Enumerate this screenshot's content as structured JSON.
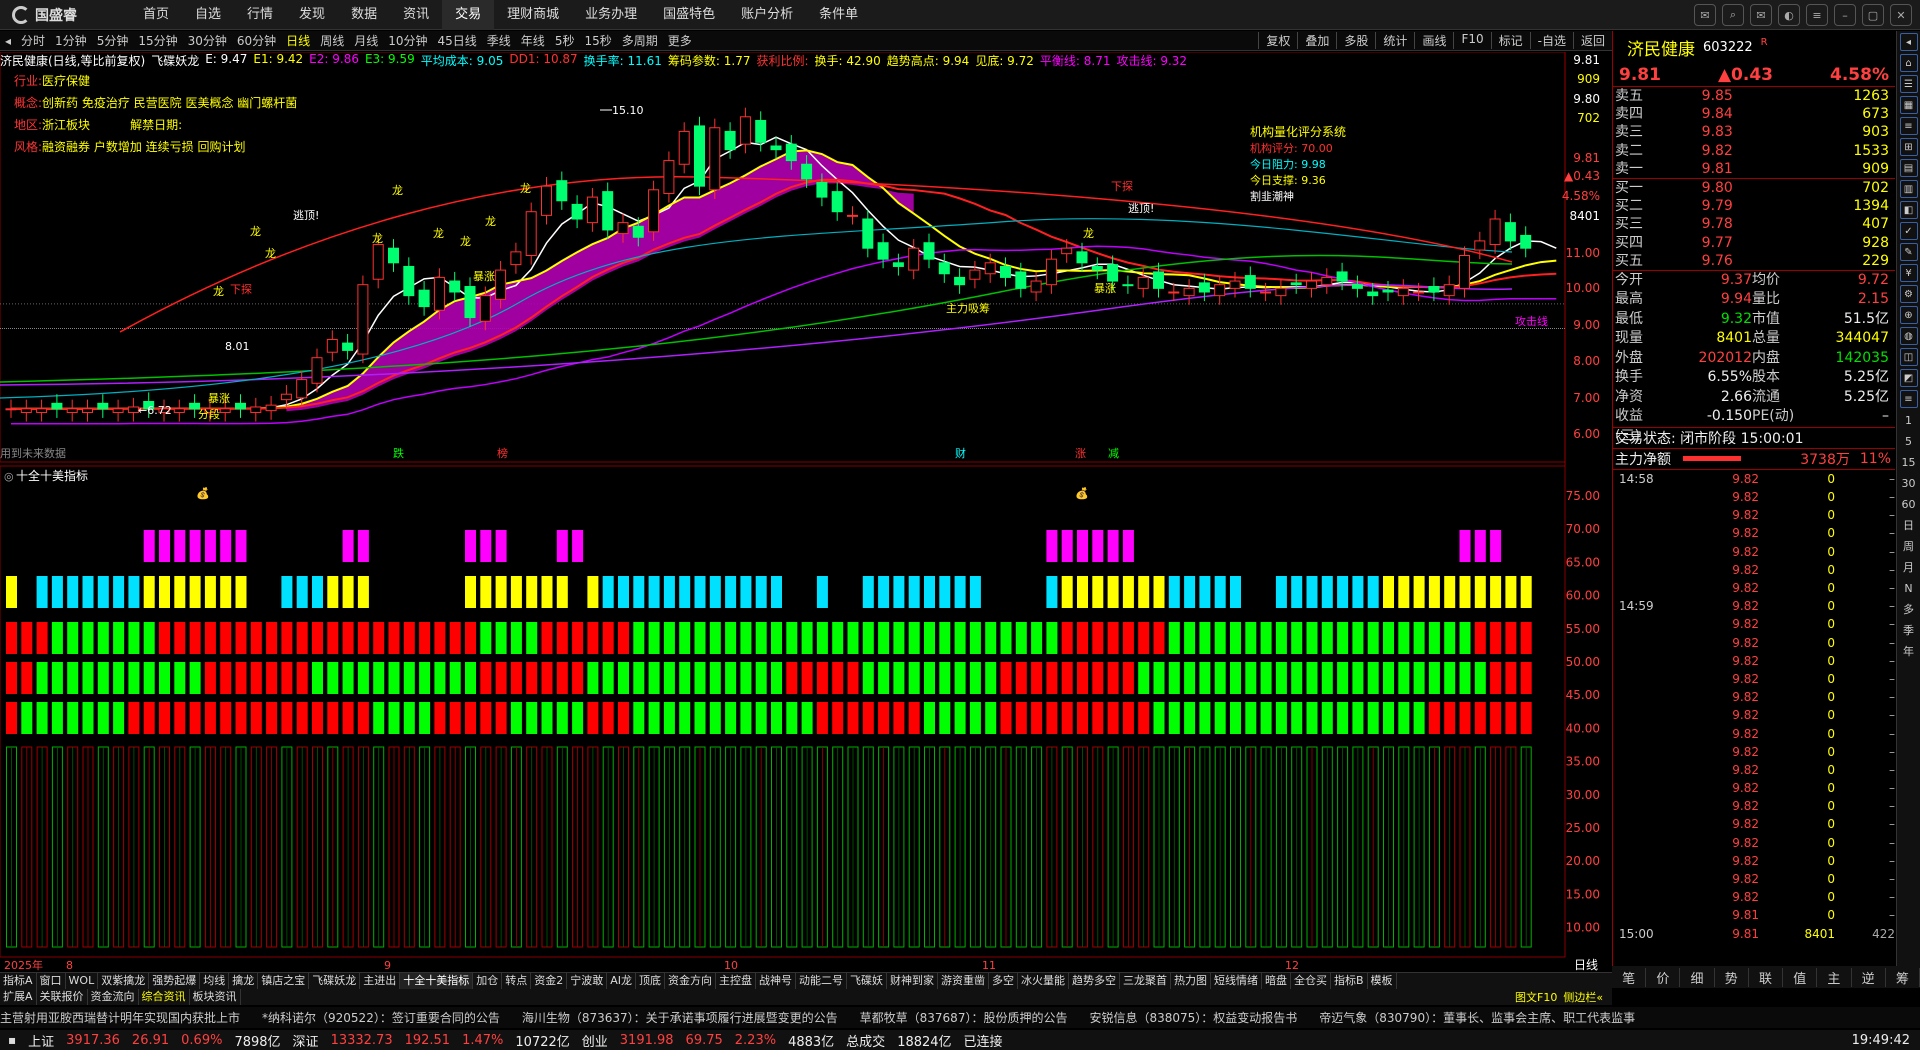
{
  "app": {
    "logo": "国盛睿",
    "menu": [
      "首页",
      "自选",
      "行情",
      "发现",
      "数据",
      "资讯",
      "交易",
      "理财商城",
      "业务办理",
      "国盛特色",
      "账户分析",
      "条件单"
    ],
    "active": "交易"
  },
  "periods": [
    "分时",
    "1分钟",
    "5分钟",
    "15分钟",
    "30分钟",
    "60分钟",
    "日线",
    "周线",
    "月线",
    "10分钟",
    "45日线",
    "季线",
    "年线",
    "5秒",
    "15秒",
    "多周期",
    "更多"
  ],
  "active_period": "日线",
  "toolbar": [
    "复权",
    "叠加",
    "多股",
    "统计",
    "画线",
    "F10",
    "标记",
    "-自选",
    "返回"
  ],
  "chart": {
    "title": "济民健康(日线,等比前复权)",
    "indicator": "飞碟妖龙",
    "items": [
      {
        "t": "E: 9.47",
        "c": "#ffffff"
      },
      {
        "t": "E1: 9.42",
        "c": "#ffff00"
      },
      {
        "t": "E2: 9.86",
        "c": "#ff00ff"
      },
      {
        "t": "E3: 9.59",
        "c": "#00ff00"
      },
      {
        "t": "平均成本: 9.05",
        "c": "#00ffff"
      },
      {
        "t": "DD1: 10.87",
        "c": "#ff3030"
      },
      {
        "t": "换手率: 11.61",
        "c": "#00ffff"
      },
      {
        "t": "筹码参数: 1.77",
        "c": "#ffff00"
      },
      {
        "t": "获利比例:",
        "c": "#ff3030"
      },
      {
        "t": "换手: 42.90",
        "c": "#ffff00"
      },
      {
        "t": "趋势高点: 9.94",
        "c": "#ffff00"
      },
      {
        "t": "见底: 9.72",
        "c": "#ffff00"
      },
      {
        "t": "平衡线: 8.71",
        "c": "#ff00ff"
      },
      {
        "t": "攻击线: 9.32",
        "c": "#ff00ff"
      }
    ],
    "meta": [
      {
        "k": "行业:",
        "v": "医疗保健"
      },
      {
        "k": "概念:",
        "v": "创新药 免疫治疗 民营医院 医美概念 幽门螺杆菌"
      },
      {
        "k": "地区:",
        "v": "浙江板块",
        "k2": "解禁日期:"
      },
      {
        "k": "风格:",
        "v": "融资融券 户数增加 连续亏损 回购计划"
      }
    ],
    "system": {
      "title": "机构量化评分系统",
      "score": "机构评分: 70.00",
      "res": "今日阻力: 9.98",
      "sup": "今日支撑: 9.36",
      "note": "割韭潮神"
    },
    "labels": {
      "hi": "15.10",
      "lo": "6.72",
      "low2": "8.01",
      "tao": "逃顶!",
      "tao2": "逃顶!",
      "zhang1": "暴涨",
      "zhang2": "暴涨",
      "zhang3": "暴涨",
      "xb": "下探",
      "xb2": "下探",
      "zl": "主力吸筹",
      "gj": "攻击线",
      "fen": "分段",
      "dragon": "龙",
      "wuting": "用到未来数据"
    },
    "markers": [
      "跌",
      "榜",
      "财",
      "涨",
      "减"
    ],
    "yaxis": [
      "9.81",
      "909",
      "9.80",
      "702",
      "9.81",
      "▲0.43",
      "4.58%",
      "8401",
      "11.00",
      "10.00",
      "9.00",
      "8.00",
      "7.00",
      "6.00"
    ],
    "lower_title": "十全十美指标",
    "lower_axis": [
      "75.00",
      "70.00",
      "65.00",
      "60.00",
      "55.00",
      "50.00",
      "45.00",
      "40.00",
      "35.00",
      "30.00",
      "25.00",
      "20.00",
      "15.00",
      "10.00"
    ],
    "xaxis": [
      "2025年",
      "8",
      "9",
      "10",
      "11",
      "12"
    ],
    "period_label": "日线"
  },
  "quote": {
    "name": "济民健康",
    "code": "603222",
    "flag": "R",
    "price": "9.81",
    "chg": "▲0.43",
    "pct": "4.58%",
    "asks": [
      [
        "卖五",
        "9.85",
        "1263"
      ],
      [
        "卖四",
        "9.84",
        "673"
      ],
      [
        "卖三",
        "9.83",
        "903"
      ],
      [
        "卖二",
        "9.82",
        "1533"
      ],
      [
        "卖一",
        "9.81",
        "909"
      ]
    ],
    "bids": [
      [
        "买一",
        "9.80",
        "702"
      ],
      [
        "买二",
        "9.79",
        "1394"
      ],
      [
        "买三",
        "9.78",
        "407"
      ],
      [
        "买四",
        "9.77",
        "928"
      ],
      [
        "买五",
        "9.76",
        "229"
      ]
    ],
    "stats": [
      [
        "今开",
        "9.37",
        "均价",
        "9.72"
      ],
      [
        "最高",
        "9.94",
        "量比",
        "2.15"
      ],
      [
        "最低",
        "9.32",
        "市值",
        "51.5亿"
      ],
      [
        "现量",
        "8401",
        "总量",
        "344047"
      ],
      [
        "外盘",
        "202012",
        "内盘",
        "142035"
      ],
      [
        "换手",
        "6.55%",
        "股本",
        "5.25亿"
      ],
      [
        "净资",
        "2.66",
        "流通",
        "5.25亿"
      ],
      [
        "收益(三)",
        "-0.150",
        "PE(动)",
        "–"
      ]
    ],
    "trade_state": "交易状态: 闭市阶段 15:00:01",
    "net_label": "主力净额",
    "net_val": "3738万",
    "net_pct": "11%",
    "t1": "14:58",
    "t2": "14:59",
    "t3": "15:00",
    "ticks_a": [
      "9.82",
      "9.82",
      "9.82",
      "9.82",
      "9.82",
      "9.82",
      "9.82"
    ],
    "ticks_b": [
      "9.82",
      "9.82",
      "9.82",
      "9.82",
      "9.82",
      "9.82",
      "9.82",
      "9.82",
      "9.82",
      "9.82",
      "9.82",
      "9.82",
      "9.82",
      "9.82",
      "9.82",
      "9.82",
      "9.82"
    ],
    "last": [
      "9.81",
      "9.81"
    ],
    "last_vol": "8401",
    "last_n": "422",
    "tabs": [
      "笔",
      "价",
      "细",
      "势",
      "联",
      "值",
      "主",
      "逆",
      "筹"
    ]
  },
  "tabs": [
    "指标A",
    "窗口",
    "WOL",
    "双紫擒龙",
    "强势起爆",
    "均线",
    "擒龙",
    "镇店之宝",
    "飞碟妖龙",
    "主进出",
    "十全十美指标",
    "加仓",
    "转点",
    "资金2",
    "宁波敢",
    "AI龙",
    "顶底",
    "资金方向",
    "主控盘",
    "战神号",
    "动能二号",
    "飞碟妖",
    "财神到家",
    "游资重凿",
    "多空",
    "冰火量能",
    "趋势多空",
    "三龙聚首",
    "热力图",
    "短线情绪",
    "暗盘",
    "全仓买",
    "指标B",
    "模板"
  ],
  "active_tab": "十全十美指标",
  "tabs2": [
    "扩展A",
    "关联报价",
    "资金流向",
    "综合资讯",
    "板块资讯"
  ],
  "active_tab2": "综合资讯",
  "right_tools": [
    "图文F10",
    "侧边栏«"
  ],
  "news": [
    "主营射用亚胺西瑞替计明年实现国内获批上市",
    "*纳科诺尔（920522）：签订重要合同的公告",
    "海川生物（873637）：关于承诺事项履行进展暨变更的公告",
    "草都牧草（837687）：股份质押的公告",
    "安锐信息（838075）：权益变动报告书",
    "帝迈气象（830790）：董事长、监事会主席、职工代表监事"
  ],
  "status": {
    "sh_label": "上证",
    "sh": "3917.36",
    "sh_chg": "26.91",
    "sh_pct": "0.69%",
    "sh_amt": "7898亿",
    "sz_label": "深证",
    "sz": "13332.73",
    "sz_chg": "192.51",
    "sz_pct": "1.47%",
    "sz_amt": "10722亿",
    "cy_label": "创业",
    "cy": "3191.98",
    "cy_chg": "69.75",
    "cy_pct": "2.23%",
    "cy_amt": "4883亿",
    "total_label": "总成交",
    "total": "18824亿",
    "conn": "已连接",
    "time": "19:49:42"
  },
  "right_side": [
    "日",
    "周",
    "月",
    "N",
    "多",
    "季",
    "年"
  ]
}
